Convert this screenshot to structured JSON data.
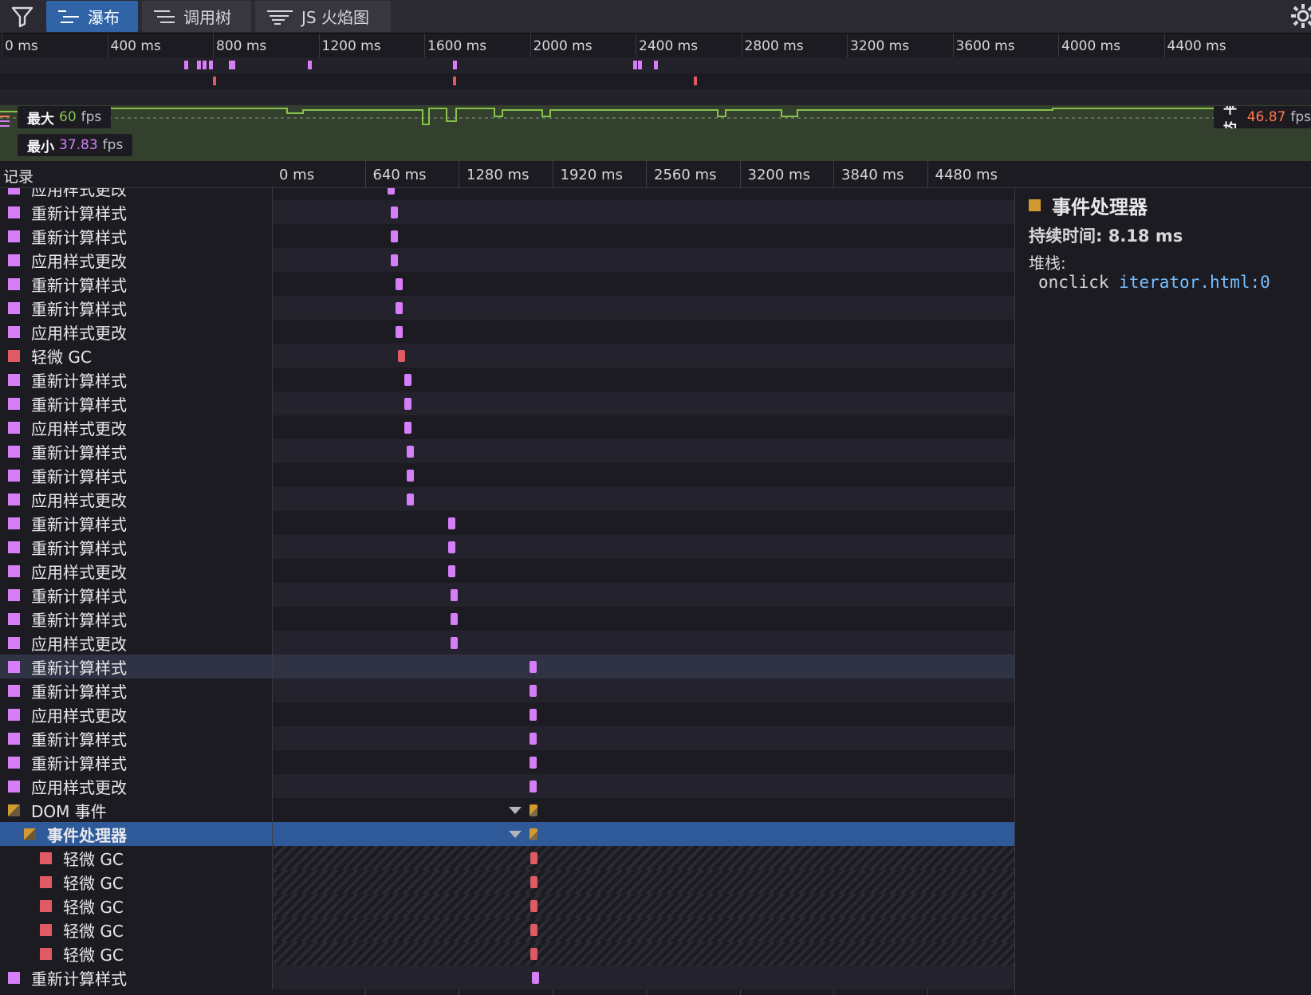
{
  "toolbar": {
    "filter_icon": "filter-icon",
    "tabs": [
      {
        "label": "瀑布",
        "icon": "waterfall-icon",
        "selected": true
      },
      {
        "label": "调用树",
        "icon": "call-tree-icon",
        "selected": false
      },
      {
        "label": "JS 火焰图",
        "icon": "flame-graph-icon",
        "selected": false
      }
    ],
    "settings_icon": "gear-icon"
  },
  "overview_ruler": {
    "ticks": [
      "0 ms",
      "400 ms",
      "800 ms",
      "1200 ms",
      "1600 ms",
      "2000 ms",
      "2400 ms",
      "2800 ms",
      "3200 ms",
      "3600 ms",
      "4000 ms",
      "4400 ms"
    ],
    "style_markers_ms": [
      690,
      740,
      760,
      785,
      860,
      870,
      1160,
      1710,
      2390,
      2410,
      2470
    ],
    "gc_markers_ms": [
      800,
      1710,
      2620
    ]
  },
  "fps": {
    "max_label": "最大",
    "max_value": "60",
    "min_label": "最小",
    "min_value": "37.83",
    "avg_label": "平均",
    "avg_value": "46.87",
    "unit": "fps"
  },
  "waterfall": {
    "records_label": "记录",
    "ticks": [
      "0 ms",
      "640 ms",
      "1280 ms",
      "1920 ms",
      "2560 ms",
      "3200 ms",
      "3840 ms",
      "4480 ms"
    ],
    "rows": [
      {
        "label": "应用样式更改",
        "kind": "style",
        "t": 770,
        "indent": 0
      },
      {
        "label": "重新计算样式",
        "kind": "style",
        "t": 790,
        "indent": 0
      },
      {
        "label": "重新计算样式",
        "kind": "style",
        "t": 790,
        "indent": 0
      },
      {
        "label": "应用样式更改",
        "kind": "style",
        "t": 790,
        "indent": 0
      },
      {
        "label": "重新计算样式",
        "kind": "style",
        "t": 820,
        "indent": 0
      },
      {
        "label": "重新计算样式",
        "kind": "style",
        "t": 820,
        "indent": 0
      },
      {
        "label": "应用样式更改",
        "kind": "style",
        "t": 820,
        "indent": 0
      },
      {
        "label": "轻微 GC",
        "kind": "gc",
        "t": 840,
        "indent": 0
      },
      {
        "label": "重新计算样式",
        "kind": "style",
        "t": 880,
        "indent": 0
      },
      {
        "label": "重新计算样式",
        "kind": "style",
        "t": 880,
        "indent": 0
      },
      {
        "label": "应用样式更改",
        "kind": "style",
        "t": 880,
        "indent": 0
      },
      {
        "label": "重新计算样式",
        "kind": "style",
        "t": 900,
        "indent": 0
      },
      {
        "label": "重新计算样式",
        "kind": "style",
        "t": 900,
        "indent": 0
      },
      {
        "label": "应用样式更改",
        "kind": "style",
        "t": 900,
        "indent": 0
      },
      {
        "label": "重新计算样式",
        "kind": "style",
        "t": 1180,
        "indent": 0
      },
      {
        "label": "重新计算样式",
        "kind": "style",
        "t": 1180,
        "indent": 0
      },
      {
        "label": "应用样式更改",
        "kind": "style",
        "t": 1180,
        "indent": 0
      },
      {
        "label": "重新计算样式",
        "kind": "style",
        "t": 1200,
        "indent": 0
      },
      {
        "label": "重新计算样式",
        "kind": "style",
        "t": 1200,
        "indent": 0
      },
      {
        "label": "应用样式更改",
        "kind": "style",
        "t": 1200,
        "indent": 0
      },
      {
        "label": "重新计算样式",
        "kind": "style",
        "t": 1740,
        "indent": 0,
        "hover": true
      },
      {
        "label": "重新计算样式",
        "kind": "style",
        "t": 1740,
        "indent": 0
      },
      {
        "label": "应用样式更改",
        "kind": "style",
        "t": 1740,
        "indent": 0
      },
      {
        "label": "重新计算样式",
        "kind": "style",
        "t": 1740,
        "indent": 0
      },
      {
        "label": "重新计算样式",
        "kind": "style",
        "t": 1740,
        "indent": 0
      },
      {
        "label": "应用样式更改",
        "kind": "style",
        "t": 1740,
        "indent": 0
      },
      {
        "label": "DOM 事件",
        "kind": "dom",
        "t": 1740,
        "indent": 0,
        "expanded": true
      },
      {
        "label": "事件处理器",
        "kind": "dom",
        "t": 1740,
        "indent": 1,
        "expanded": true,
        "selected": true
      },
      {
        "label": "轻微 GC",
        "kind": "gc",
        "t": 1745,
        "indent": 2
      },
      {
        "label": "轻微 GC",
        "kind": "gc",
        "t": 1745,
        "indent": 2
      },
      {
        "label": "轻微 GC",
        "kind": "gc",
        "t": 1745,
        "indent": 2
      },
      {
        "label": "轻微 GC",
        "kind": "gc",
        "t": 1745,
        "indent": 2
      },
      {
        "label": "轻微 GC",
        "kind": "gc",
        "t": 1745,
        "indent": 2
      },
      {
        "label": "重新计算样式",
        "kind": "style",
        "t": 1755,
        "indent": 0
      }
    ]
  },
  "details": {
    "title": "事件处理器",
    "duration_label": "持续时间:",
    "duration_value": "8.18 ms",
    "stack_label": "堆栈:",
    "frame_fn": "onclick",
    "frame_link": "iterator.html:0"
  },
  "colors": {
    "style": "#d67ef8",
    "gc": "#e05a63",
    "dom": "#d19a30",
    "selected_row": "#2f5a9a",
    "fps_line": "#87c24a",
    "fps_min": "#d67ef8",
    "fps_avg": "#ff7a4d",
    "fps_max": "#87c24a"
  }
}
